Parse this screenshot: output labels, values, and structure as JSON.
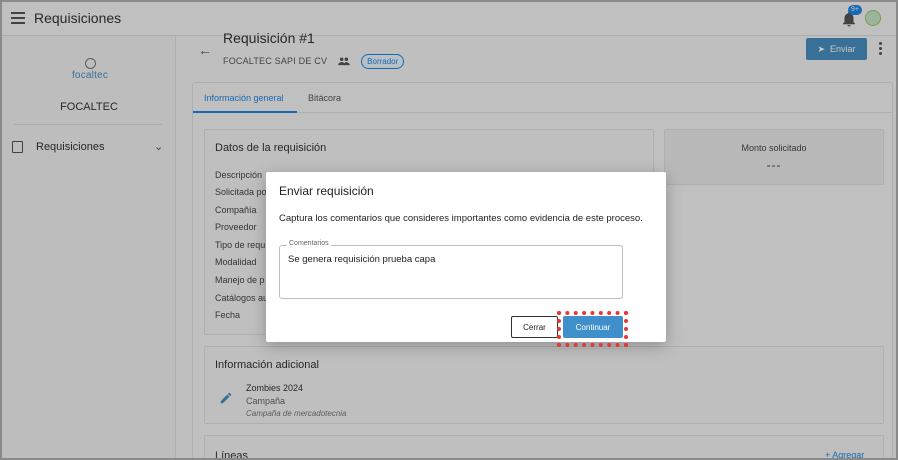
{
  "app": {
    "title": "Requisiciones",
    "notification_badge": "9+"
  },
  "sidebar": {
    "logo_text": "focaltec",
    "company": "FOCALTEC",
    "items": [
      {
        "label": "Requisiciones"
      }
    ]
  },
  "header": {
    "title": "Requisición #1",
    "company": "FOCALTEC SAPI DE CV",
    "status": "Borrador",
    "send_label": "Enviar"
  },
  "tabs": [
    {
      "label": "Información general"
    },
    {
      "label": "Bitácora"
    }
  ],
  "datos": {
    "title": "Datos de la requisición",
    "fields": [
      "Descripción",
      "Solicitada po",
      "Compañía",
      "Proveedor",
      "Tipo de requ",
      "Modalidad",
      "Manejo de p",
      "Catálogos au",
      "Fecha"
    ]
  },
  "monto": {
    "title": "Monto solicitado",
    "value": "---"
  },
  "info": {
    "title": "Información adicional",
    "name": "Zombies 2024",
    "type": "Campaña",
    "description": "Campaña de mercadotecnia"
  },
  "lineas": {
    "title": "Líneas",
    "add_label": "Agregar"
  },
  "dialog": {
    "title": "Enviar requisición",
    "text": "Captura los comentarios que consideres importantes como evidencia de este proceso.",
    "comments_label": "Comentarios",
    "comments_value": "Se genera requisición prueba capa",
    "cancel_label": "Cerrar",
    "confirm_label": "Continuar"
  },
  "colors": {
    "accent": "#1e88e5",
    "primary_button": "#3f8fcb",
    "highlight": "#e53935"
  }
}
